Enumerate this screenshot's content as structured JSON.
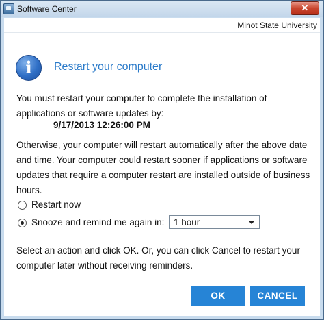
{
  "window": {
    "title": "Software Center",
    "close_label": "✕",
    "organization": "Minot State University"
  },
  "dialog": {
    "icon": "info-icon",
    "title": "Restart your computer",
    "message_1": "You must restart your computer to complete the installation of applications or software updates by:",
    "deadline": "9/17/2013 12:26:00 PM",
    "message_2": "Otherwise, your computer will restart automatically after the above date and time.  Your computer could restart sooner if applications or software updates that require a computer restart are installed outside of business hours.",
    "option_restart_now": "Restart now",
    "option_snooze": "Snooze and remind me again in:",
    "selected_option": "snooze",
    "snooze_value": "1 hour",
    "instructions": "Select an action and click OK.  Or, you can click Cancel to restart your computer later without receiving reminders.",
    "ok_label": "OK",
    "cancel_label": "CANCEL"
  },
  "colors": {
    "accent": "#2684d6",
    "title": "#2a7ac9"
  }
}
